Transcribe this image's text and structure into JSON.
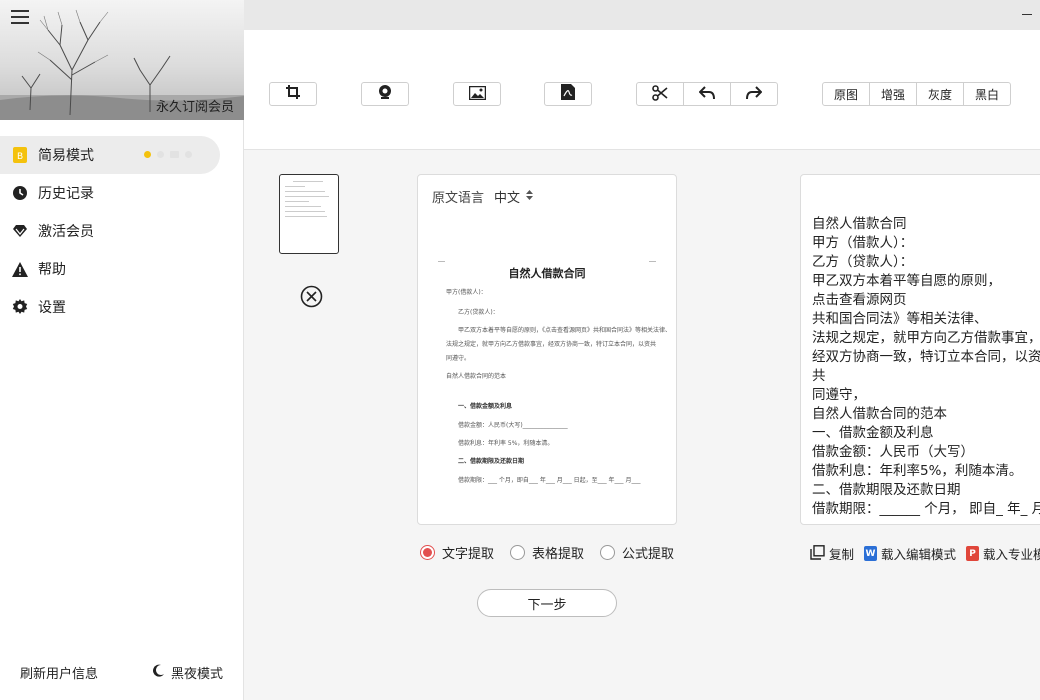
{
  "sidebar": {
    "member_label": "永久订阅会员",
    "items": [
      {
        "label": "简易模式",
        "icon": "doc-badge-icon",
        "active": true
      },
      {
        "label": "历史记录",
        "icon": "clock-icon",
        "active": false
      },
      {
        "label": "激活会员",
        "icon": "diamond-icon",
        "active": false
      },
      {
        "label": "帮助",
        "icon": "warning-icon",
        "active": false
      },
      {
        "label": "设置",
        "icon": "gear-icon",
        "active": false
      }
    ],
    "refresh_label": "刷新用户信息",
    "night_label": "黑夜模式"
  },
  "toolbar": {
    "icons": [
      "crop-icon",
      "camera-icon",
      "image-icon",
      "pdf-icon",
      "scissors-icon",
      "undo-icon",
      "redo-icon"
    ],
    "filters": [
      "原图",
      "增强",
      "灰度",
      "黑白"
    ]
  },
  "doc": {
    "lang_label": "原文语言",
    "lang_value": "中文",
    "title": "自然人借款合同",
    "lines": [
      "甲方(借款人)：",
      "乙方(贷款人)：",
      "甲乙双方本着平等自愿的原则，《点击查看源网页》共和国合同法》等相关法律、",
      "法规之规定，就甲方向乙方借款事宜，经双方协商一致，特订立本合同，以资共",
      "同遵守。",
      "自然人借款合同的范本",
      "一、借款金额及利息",
      "借款金额：人民币(大写)_______________",
      "借款利息：年利率 5%，利随本清。",
      "二、借款期限及还款日期",
      "借款期限：___ 个月，即自___ 年___ 月___ 日起，至___ 年___ 月___"
    ]
  },
  "text_result": {
    "lines": [
      "自然人借款合同",
      "甲方（借款人）：",
      "乙方（贷款人）：",
      "甲乙双方本着平等自愿的原则，",
      "点击查看源网页",
      "共和国合同法》等相关法律、",
      "法规之规定，就甲方向乙方借款事宜，",
      "经双方协商一致，特订立本合同，以资",
      "共",
      "同遵守，",
      "自然人借款合同的范本",
      "一、借款金额及利息",
      "借款金额：人民币（大写）",
      "借款利息：年利率5%，利随本清。",
      "二、借款期限及还款日期",
      "借款期限：______ 个月， 即自_ 年_ 月"
    ]
  },
  "options": [
    {
      "label": "文字提取",
      "selected": true
    },
    {
      "label": "表格提取",
      "selected": false
    },
    {
      "label": "公式提取",
      "selected": false
    }
  ],
  "actions": {
    "copy": "复制",
    "word": "载入编辑模式",
    "word_badge": "W",
    "ppt": "载入专业模",
    "ppt_badge": "P"
  },
  "next_label": "下一步",
  "colors": {
    "accent_red": "#e25050",
    "active_dot": "#f4c20d",
    "word_blue": "#2b6fd6",
    "ppt_red": "#e0463a"
  }
}
